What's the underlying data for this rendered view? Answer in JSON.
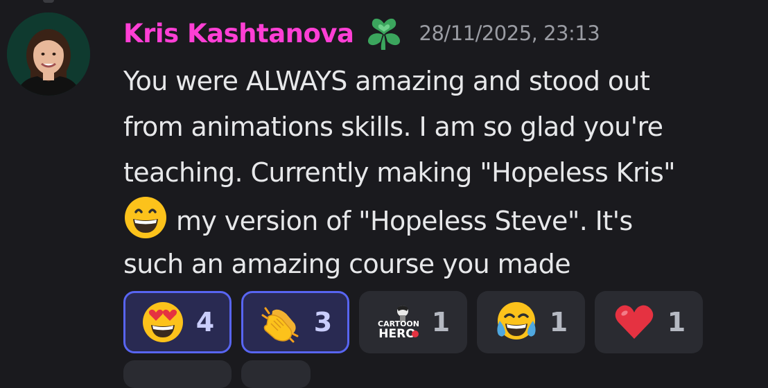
{
  "message": {
    "author": "Kris Kashtanova",
    "author_color": "#ff3fd5",
    "role_icon": "clover-heart-icon",
    "timestamp": "28/11/2025, 23:13",
    "content_lines": [
      "You were ALWAYS amazing and stood out",
      "from animations skills. I am so glad you're",
      "teaching. Currently making \"Hopeless Kris\"",
      "my version of \"Hopeless Steve\". It's",
      "such an amazing course you made"
    ],
    "inline_emoji": "grinning-face-icon"
  },
  "reactions": [
    {
      "emoji": "heart-eyes-face-icon",
      "count": "4",
      "active": true
    },
    {
      "emoji": "clapping-hands-icon",
      "count": "3",
      "active": true
    },
    {
      "emoji": "cartoon-hero-custom-emoji",
      "count": "1",
      "active": false,
      "emoji_text": [
        "CARTOON",
        "HERO"
      ]
    },
    {
      "emoji": "tears-of-joy-face-icon",
      "count": "1",
      "active": false
    },
    {
      "emoji": "red-heart-icon",
      "count": "1",
      "active": false
    }
  ],
  "colors": {
    "background": "#1a1a1e",
    "reaction_bg": "#2a2b31",
    "reaction_active_border": "#5865f2",
    "timestamp": "#9a9ca3"
  }
}
